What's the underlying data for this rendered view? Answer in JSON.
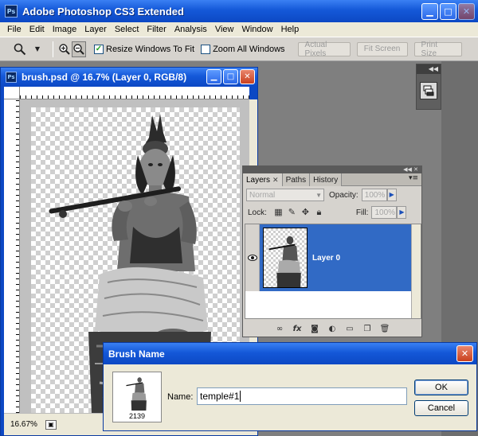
{
  "app": {
    "logo": "Ps",
    "title": "Adobe Photoshop CS3 Extended"
  },
  "menu": [
    "File",
    "Edit",
    "Image",
    "Layer",
    "Select",
    "Filter",
    "Analysis",
    "View",
    "Window",
    "Help"
  ],
  "options": {
    "tool_icon": "zoom-icon",
    "resize_label": "Resize Windows To Fit",
    "resize_checked": true,
    "zoom_all_label": "Zoom All Windows",
    "zoom_all_checked": false,
    "actual_pixels": "Actual Pixels",
    "fit_screen": "Fit Screen",
    "print_size": "Print Size"
  },
  "document": {
    "logo": "Ps",
    "title": "brush.psd @ 16.7% (Layer 0, RGB/8)",
    "zoom": "16.67%"
  },
  "layers_panel": {
    "tabs": [
      "Layers",
      "Paths",
      "History"
    ],
    "active_tab": "Layers",
    "blend_mode": "Normal",
    "opacity_label": "Opacity:",
    "opacity_value": "100%",
    "lock_label": "Lock:",
    "fill_label": "Fill:",
    "fill_value": "100%",
    "layer_name": "Layer 0",
    "layer_visible": true
  },
  "dialog": {
    "title": "Brush Name",
    "brush_size": "2139",
    "name_label": "Name:",
    "name_value": "temple#1",
    "ok": "OK",
    "cancel": "Cancel"
  },
  "colors": {
    "title_blue": "#1458d8",
    "selection_blue": "#316ac5",
    "close_red": "#c9401e",
    "panel_gray": "#d6d3ce"
  }
}
